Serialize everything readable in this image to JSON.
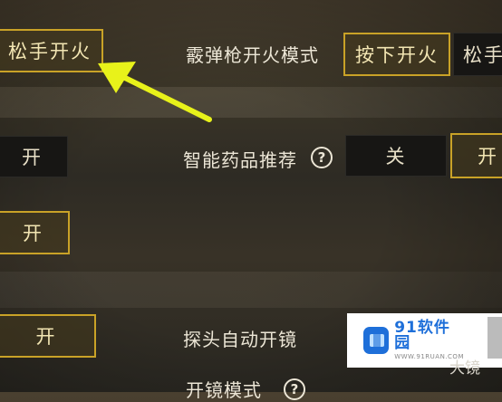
{
  "settings": {
    "top_left_button": "松手开火",
    "shotgun_fire_mode": {
      "label": "霰弹枪开火模式",
      "selected": "按下开火",
      "other": "松手"
    },
    "left_toggle_1": "开",
    "smart_medicine": {
      "label": "智能药品推荐",
      "off": "关",
      "on": "开"
    },
    "left_toggle_2": "开",
    "left_toggle_3": "开",
    "peek_auto_scope": {
      "label": "探头自动开镜",
      "right_partial": "开"
    },
    "scope_mode": {
      "label": "开镜模式"
    }
  },
  "watermark": {
    "brand": "91软件园",
    "sub": "WWW.91RUAN.COM"
  },
  "bottom_partial_text": "大镜",
  "annotation": {
    "arrow_color": "#e8f21a"
  }
}
